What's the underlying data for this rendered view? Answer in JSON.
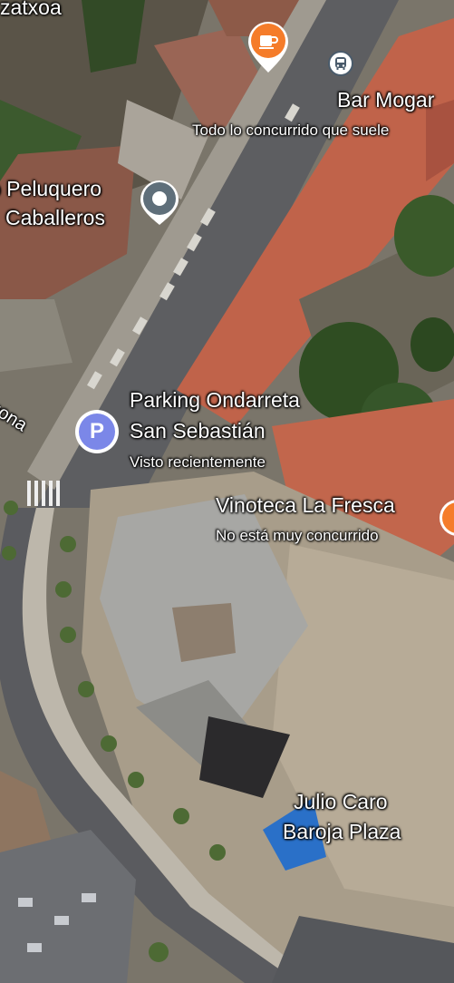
{
  "map": {
    "type": "satellite",
    "places": [
      {
        "id": "bar-mogan",
        "name": "Bar Mogar",
        "status": "Todo lo concurrido que suele",
        "category": "cafe-icon",
        "color": "#F57C2A"
      },
      {
        "id": "peluquero",
        "name_line1": "o Peluquero",
        "name_line2": "Caballeros",
        "category": "place-pin-icon",
        "color": "#5F6F7A"
      },
      {
        "id": "parking",
        "name_line1": "Parking Ondarreta",
        "name_line2": "San Sebastián",
        "status": "Visto recientemente",
        "category": "parking-icon",
        "icon_text": "P",
        "color": "#7B87E8"
      },
      {
        "id": "vinoteca",
        "name": "Vinoteca La Fresca",
        "status": "No está muy concurrido",
        "color": "#F57C2A"
      },
      {
        "id": "plaza",
        "name_line1": "Julio Caro",
        "name_line2": "Baroja Plaza"
      }
    ],
    "streets": [
      "zatxoa",
      "uona"
    ],
    "transit": {
      "category": "bus-icon"
    }
  }
}
